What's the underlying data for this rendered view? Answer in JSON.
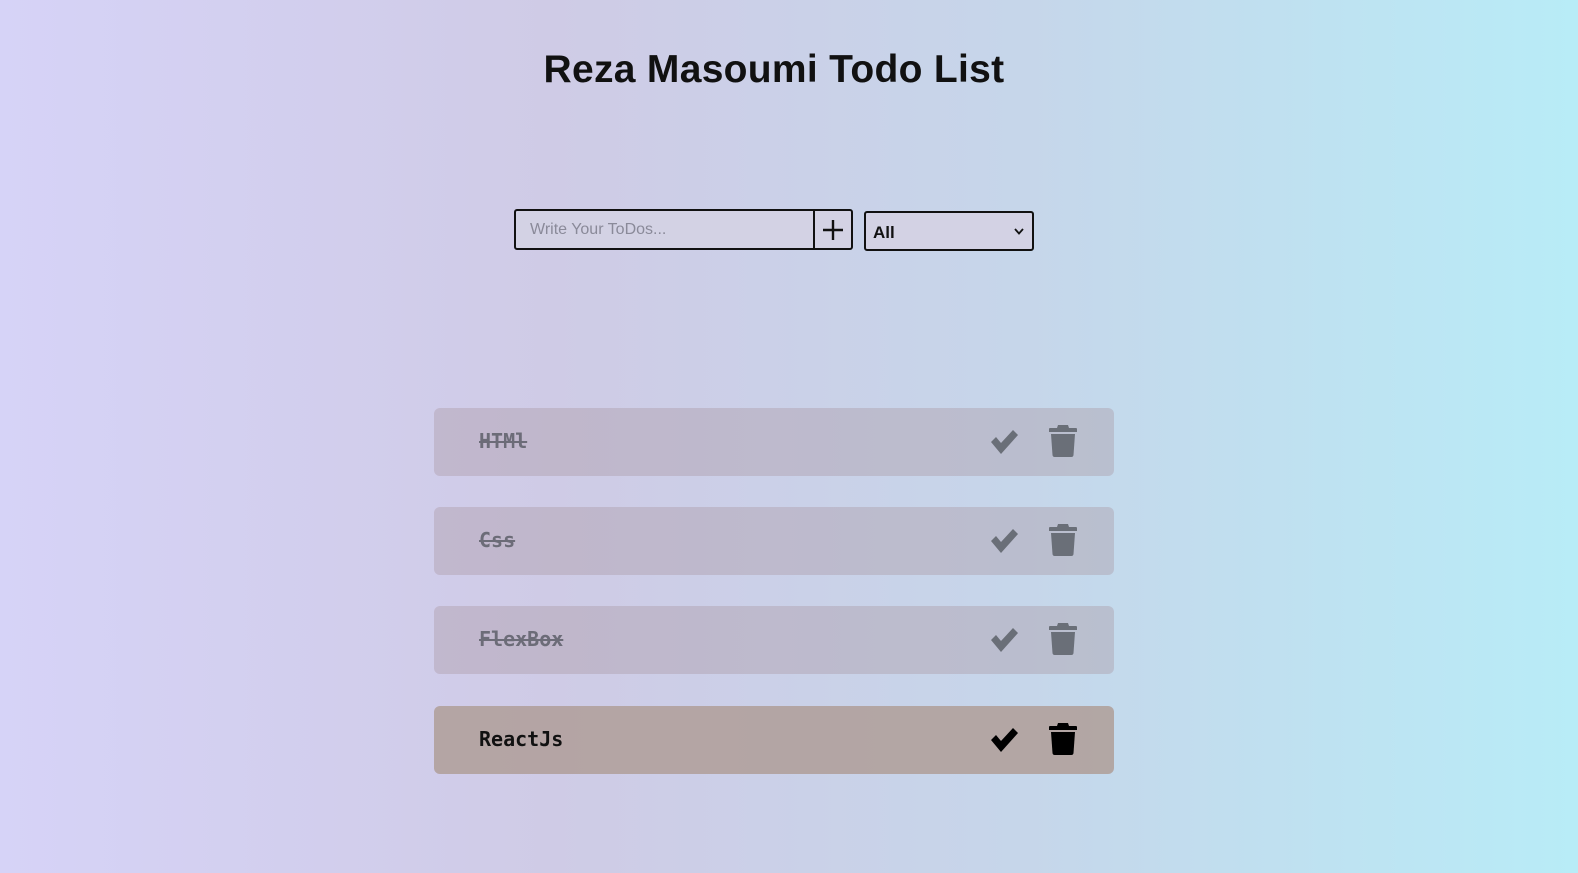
{
  "header": {
    "title": "Reza Masoumi Todo List"
  },
  "form": {
    "input_placeholder": "Write Your ToDos...",
    "input_value": "",
    "add_icon": "plus-icon",
    "filter": {
      "selected": "All"
    }
  },
  "todos": [
    {
      "text": "HTMl",
      "completed": true
    },
    {
      "text": "Css",
      "completed": true
    },
    {
      "text": "FlexBox",
      "completed": true
    },
    {
      "text": "ReactJs",
      "completed": false
    }
  ],
  "icons": {
    "complete": "check-icon",
    "delete": "trash-icon"
  },
  "colors": {
    "gradient_left": "#d6d3f7",
    "gradient_right": "#b8ecf7",
    "completed_icon": "#6a6f78",
    "active_icon": "#000000"
  }
}
